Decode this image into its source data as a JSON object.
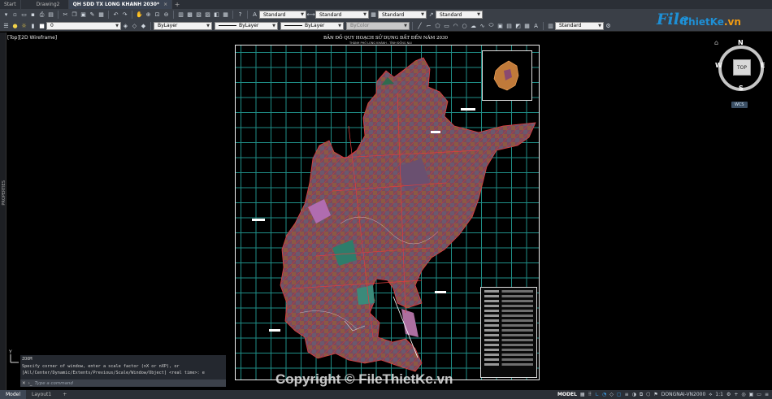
{
  "tabs": {
    "start": "Start",
    "drawing2": "Drawing2",
    "active": "QH SDD TX LONG KHANH 2030*",
    "close": "×",
    "add": "+"
  },
  "styles": {
    "text_style": "Standard",
    "dim_style": "Standard",
    "table_style": "Standard",
    "mleader_style": "Standard",
    "plot_style": "Standard"
  },
  "layers": {
    "current_layer": "0",
    "color": "ByLayer",
    "linetype": "ByLayer",
    "lineweight": "ByLayer",
    "plotstyle": "ByColor"
  },
  "viewport_label": "[Top][2D Wireframe]",
  "side_palette": "PROPERTIES",
  "map": {
    "title": "BẢN ĐỒ QUY HOẠCH SỬ DỤNG ĐẤT ĐẾN NĂM 2030",
    "subtitle": "THÀNH PHỐ LONG KHÁNH - TỈNH ĐỒNG NAI"
  },
  "viewcube": {
    "top": "TOP",
    "n": "N",
    "s": "S",
    "e": "E",
    "w": "W",
    "wcs": "WCS"
  },
  "command": {
    "ucs_y": "Y",
    "history": [
      "ZOOM",
      "Specify corner of window, enter a scale factor (nX or nXP), or",
      "[All/Center/Dynamic/Extents/Previous/Scale/Window/Object] <real time>: e"
    ],
    "placeholder": "Type a command"
  },
  "watermarks": {
    "logo_f": "File",
    "logo_rest": "ThietKe",
    "logo_vn": ".vn",
    "copyright": "Copyright © FileThietKe.vn"
  },
  "layout_tabs": {
    "model": "Model",
    "layout1": "Layout1",
    "add": "+"
  },
  "status": {
    "model": "MODEL",
    "coordsys": "DONGNAI-VN2000",
    "scale": "1:1"
  },
  "colors": {
    "grid": "#1f8e87",
    "accent": "#1e90d6",
    "brand_orange": "#f39c12"
  }
}
